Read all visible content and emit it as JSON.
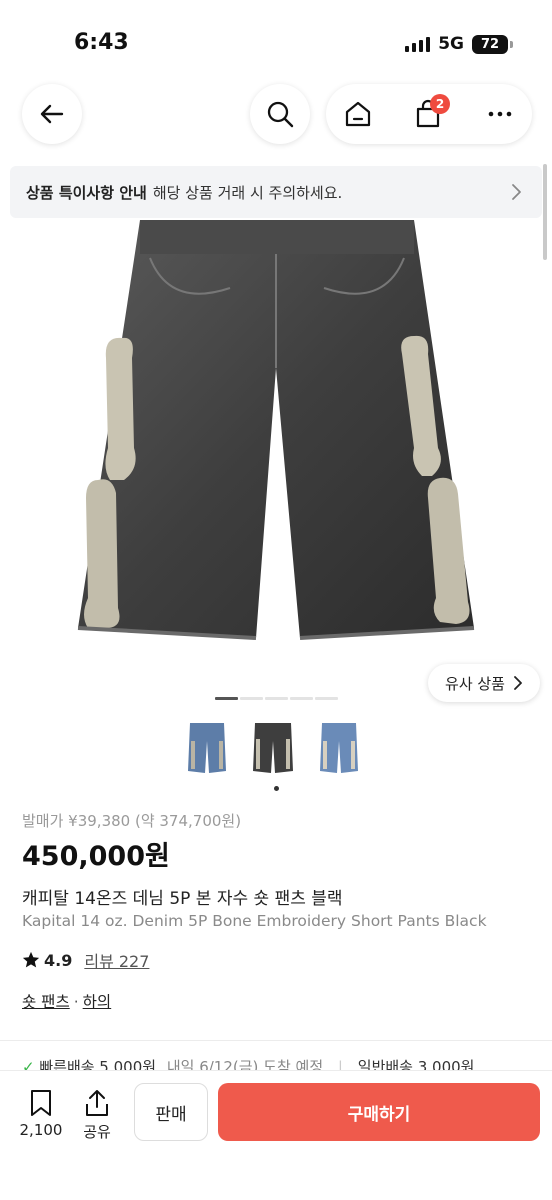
{
  "status": {
    "time": "6:43",
    "network": "5G",
    "battery": "72"
  },
  "nav": {
    "cart_badge": "2"
  },
  "notice": {
    "title": "상품 특이사항 안내",
    "message": "해당 상품 거래 시 주의하세요."
  },
  "similar": {
    "label": "유사 상품"
  },
  "gallery": {
    "total_slides": 5,
    "current_slide": 1,
    "thumbnail_count": 3,
    "selected_thumbnail": 2
  },
  "product": {
    "release_price": "발매가 ¥39,380 (약 374,700원)",
    "price": "450,000원",
    "name_ko": "캐피탈 14온즈 데님 5P 본 자수 숏 팬츠 블랙",
    "name_en": "Kapital 14 oz. Denim 5P Bone Embroidery Short Pants Black",
    "rating": "4.9",
    "reviews": "리뷰 227",
    "category": "숏 팬츠",
    "category_parent": "하의",
    "category_sep": "·"
  },
  "shipping": {
    "fast": "빠른배송 5,000원",
    "fast_eta": "내일 6/12(금) 도착 예정",
    "normal": "일반배송 3,000원"
  },
  "bottom": {
    "bookmark_count": "2,100",
    "share_label": "공유",
    "sell_label": "판매",
    "buy_label": "구매하기"
  },
  "colors": {
    "accent": "#ef5a4c",
    "badge": "#ef4b3f",
    "notice_bg": "#f3f4f6"
  },
  "icons": [
    "back-arrow-icon",
    "search-icon",
    "home-icon",
    "bag-icon",
    "more-icon",
    "chevron-right-icon",
    "star-icon",
    "bookmark-icon",
    "share-icon"
  ]
}
